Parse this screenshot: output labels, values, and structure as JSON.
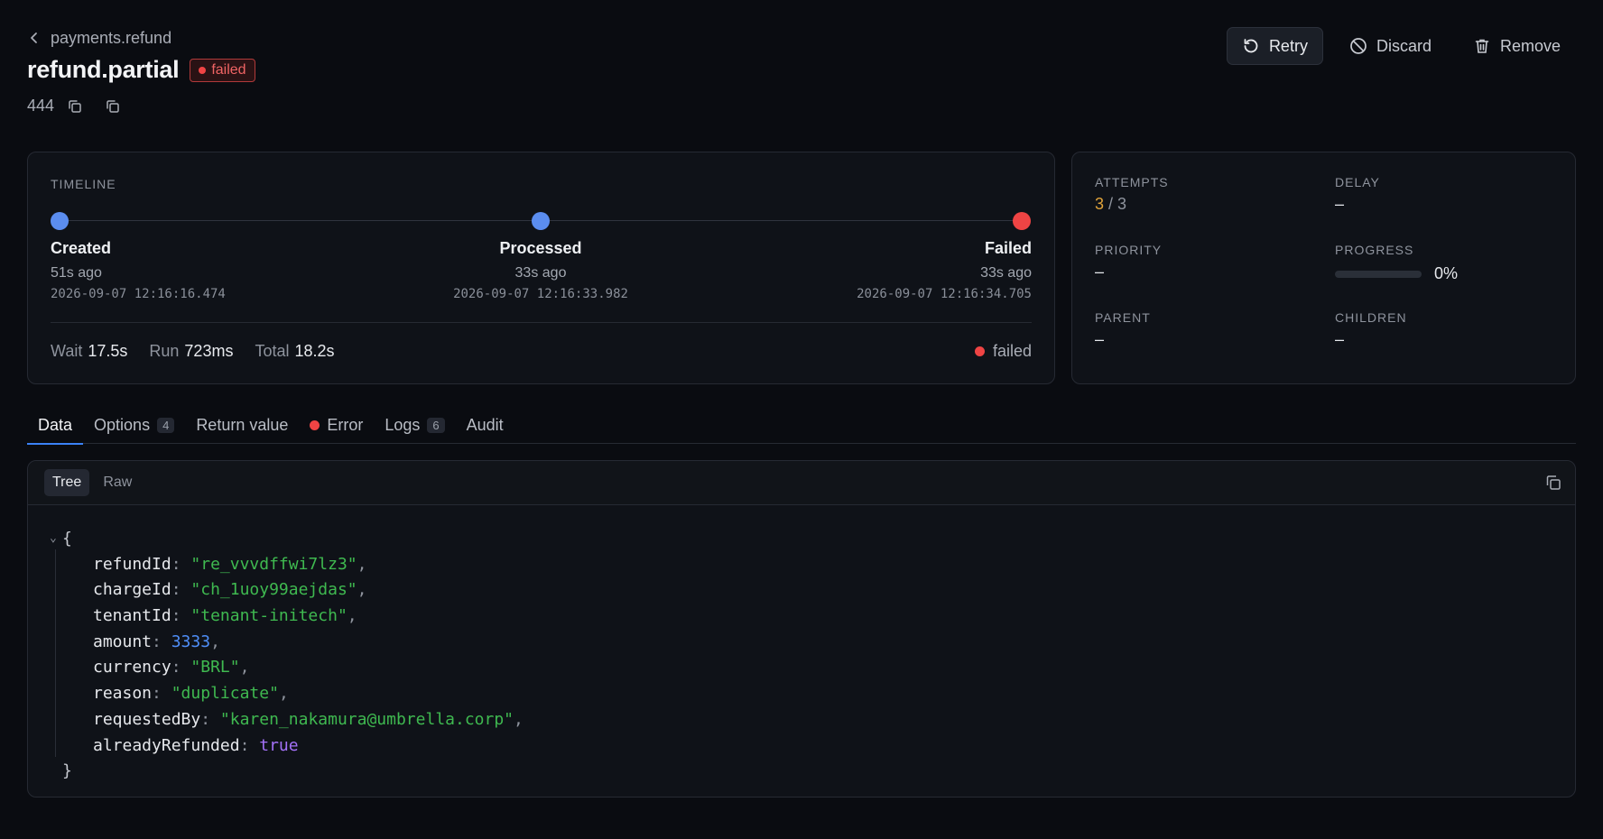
{
  "breadcrumb": {
    "parent": "payments.refund"
  },
  "job": {
    "name": "refund.partial",
    "status": "failed",
    "id": "444"
  },
  "actions": {
    "retry": "Retry",
    "discard": "Discard",
    "remove": "Remove"
  },
  "timeline": {
    "label": "TIMELINE",
    "steps": [
      {
        "name": "Created",
        "ago": "51s ago",
        "timestamp": "2026-09-07 12:16:16.474",
        "color": "#5b8def"
      },
      {
        "name": "Processed",
        "ago": "33s ago",
        "timestamp": "2026-09-07 12:16:33.982",
        "color": "#5b8def"
      },
      {
        "name": "Failed",
        "ago": "33s ago",
        "timestamp": "2026-09-07 12:16:34.705",
        "color": "#ef4444"
      }
    ],
    "stats": {
      "wait_label": "Wait",
      "wait": "17.5s",
      "run_label": "Run",
      "run": "723ms",
      "total_label": "Total",
      "total": "18.2s"
    },
    "status": "failed"
  },
  "meta": {
    "attempts_label": "ATTEMPTS",
    "attempts_current": "3",
    "attempts_max": " / 3",
    "delay_label": "DELAY",
    "delay": "–",
    "priority_label": "PRIORITY",
    "priority": "–",
    "progress_label": "PROGRESS",
    "progress_text": "0%",
    "progress_value": 0,
    "parent_label": "PARENT",
    "parent": "–",
    "children_label": "CHILDREN",
    "children": "–"
  },
  "tabs": [
    {
      "label": "Data",
      "count": null
    },
    {
      "label": "Options",
      "count": "4"
    },
    {
      "label": "Return value",
      "count": null
    },
    {
      "label": "Error",
      "count": null
    },
    {
      "label": "Logs",
      "count": "6"
    },
    {
      "label": "Audit",
      "count": null
    }
  ],
  "view_modes": {
    "tree": "Tree",
    "raw": "Raw"
  },
  "payload": {
    "open_brace": "{",
    "close_brace": "}",
    "fields": [
      {
        "key": "refundId",
        "value": "\"re_vvvdffwi7lz3\"",
        "type": "string"
      },
      {
        "key": "chargeId",
        "value": "\"ch_1uoy99aejdas\"",
        "type": "string"
      },
      {
        "key": "tenantId",
        "value": "\"tenant-initech\"",
        "type": "string"
      },
      {
        "key": "amount",
        "value": "3333",
        "type": "number"
      },
      {
        "key": "currency",
        "value": "\"BRL\"",
        "type": "string"
      },
      {
        "key": "reason",
        "value": "\"duplicate\"",
        "type": "string"
      },
      {
        "key": "requestedBy",
        "value": "\"karen_nakamura@umbrella.corp\"",
        "type": "string"
      },
      {
        "key": "alreadyRefunded",
        "value": "true",
        "type": "boolean"
      }
    ]
  }
}
